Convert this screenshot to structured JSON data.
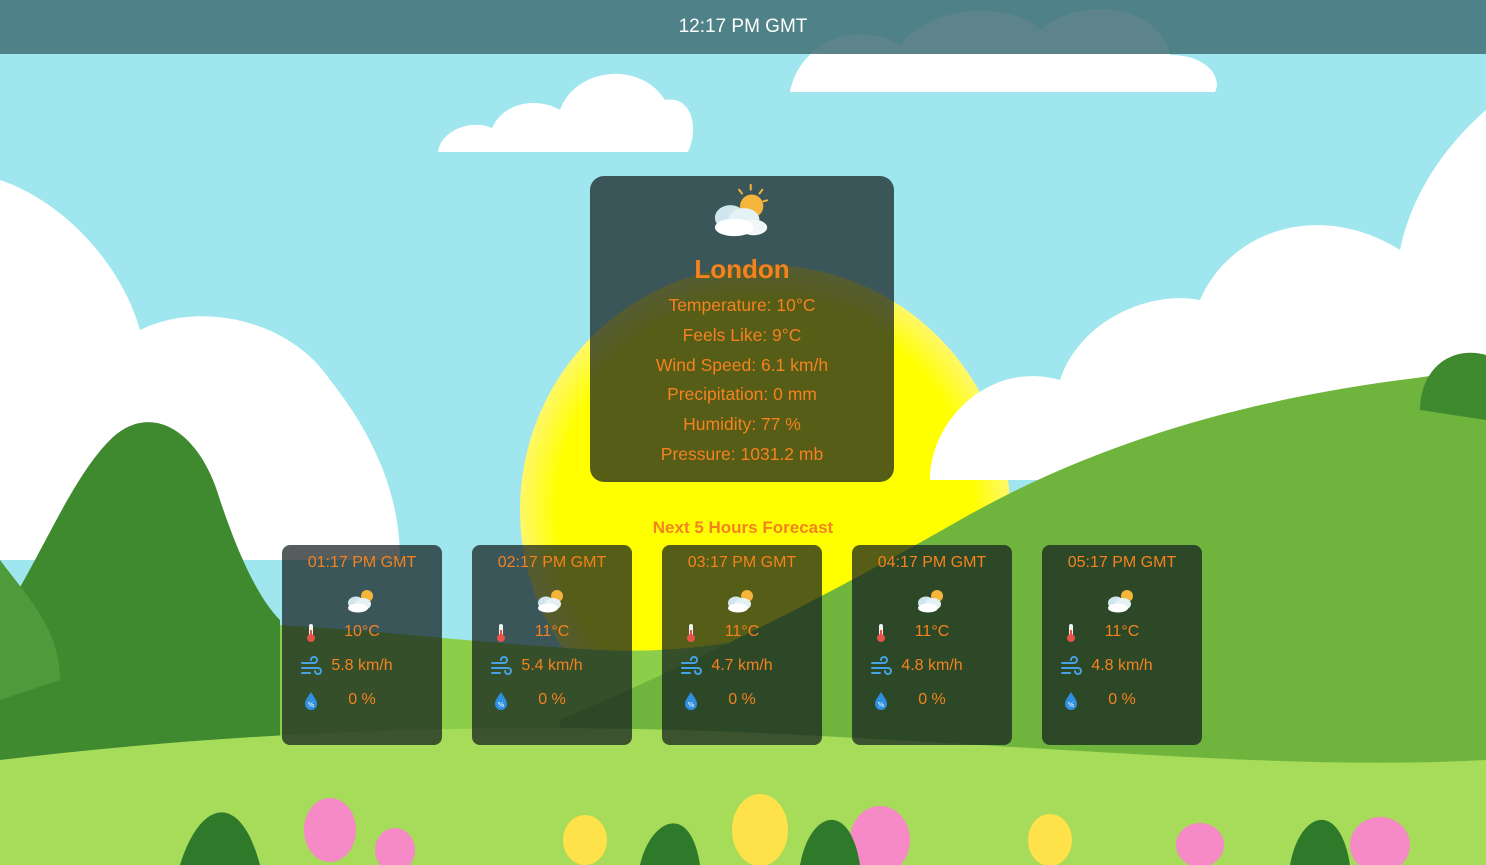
{
  "header": {
    "time": "12:17 PM GMT"
  },
  "current": {
    "icon": "partly-cloudy-icon",
    "city": "London",
    "temperature": "Temperature: 10°C",
    "feels_like": "Feels Like: 9°C",
    "wind_speed": "Wind Speed: 6.1 km/h",
    "precipitation": "Precipitation: 0 mm",
    "humidity": "Humidity: 77 %",
    "pressure": "Pressure: 1031.2 mb"
  },
  "forecast": {
    "title": "Next 5 Hours Forecast",
    "hours": [
      {
        "time": "01:17 PM GMT",
        "icon": "partly-cloudy-icon",
        "temp": "10°C",
        "wind": "5.8 km/h",
        "precip": "0 %"
      },
      {
        "time": "02:17 PM GMT",
        "icon": "partly-cloudy-icon",
        "temp": "11°C",
        "wind": "5.4 km/h",
        "precip": "0 %"
      },
      {
        "time": "03:17 PM GMT",
        "icon": "partly-cloudy-icon",
        "temp": "11°C",
        "wind": "4.7 km/h",
        "precip": "0 %"
      },
      {
        "time": "04:17 PM GMT",
        "icon": "partly-cloudy-icon",
        "temp": "11°C",
        "wind": "4.8 km/h",
        "precip": "0 %"
      },
      {
        "time": "05:17 PM GMT",
        "icon": "partly-cloudy-icon",
        "temp": "11°C",
        "wind": "4.8 km/h",
        "precip": "0 %"
      }
    ]
  },
  "colors": {
    "accent": "#f5821f",
    "sky": "#9fe6ee",
    "sun": "#ffff00",
    "hill_dark": "#4f9a3a",
    "hill_light": "#8ccd4a"
  }
}
